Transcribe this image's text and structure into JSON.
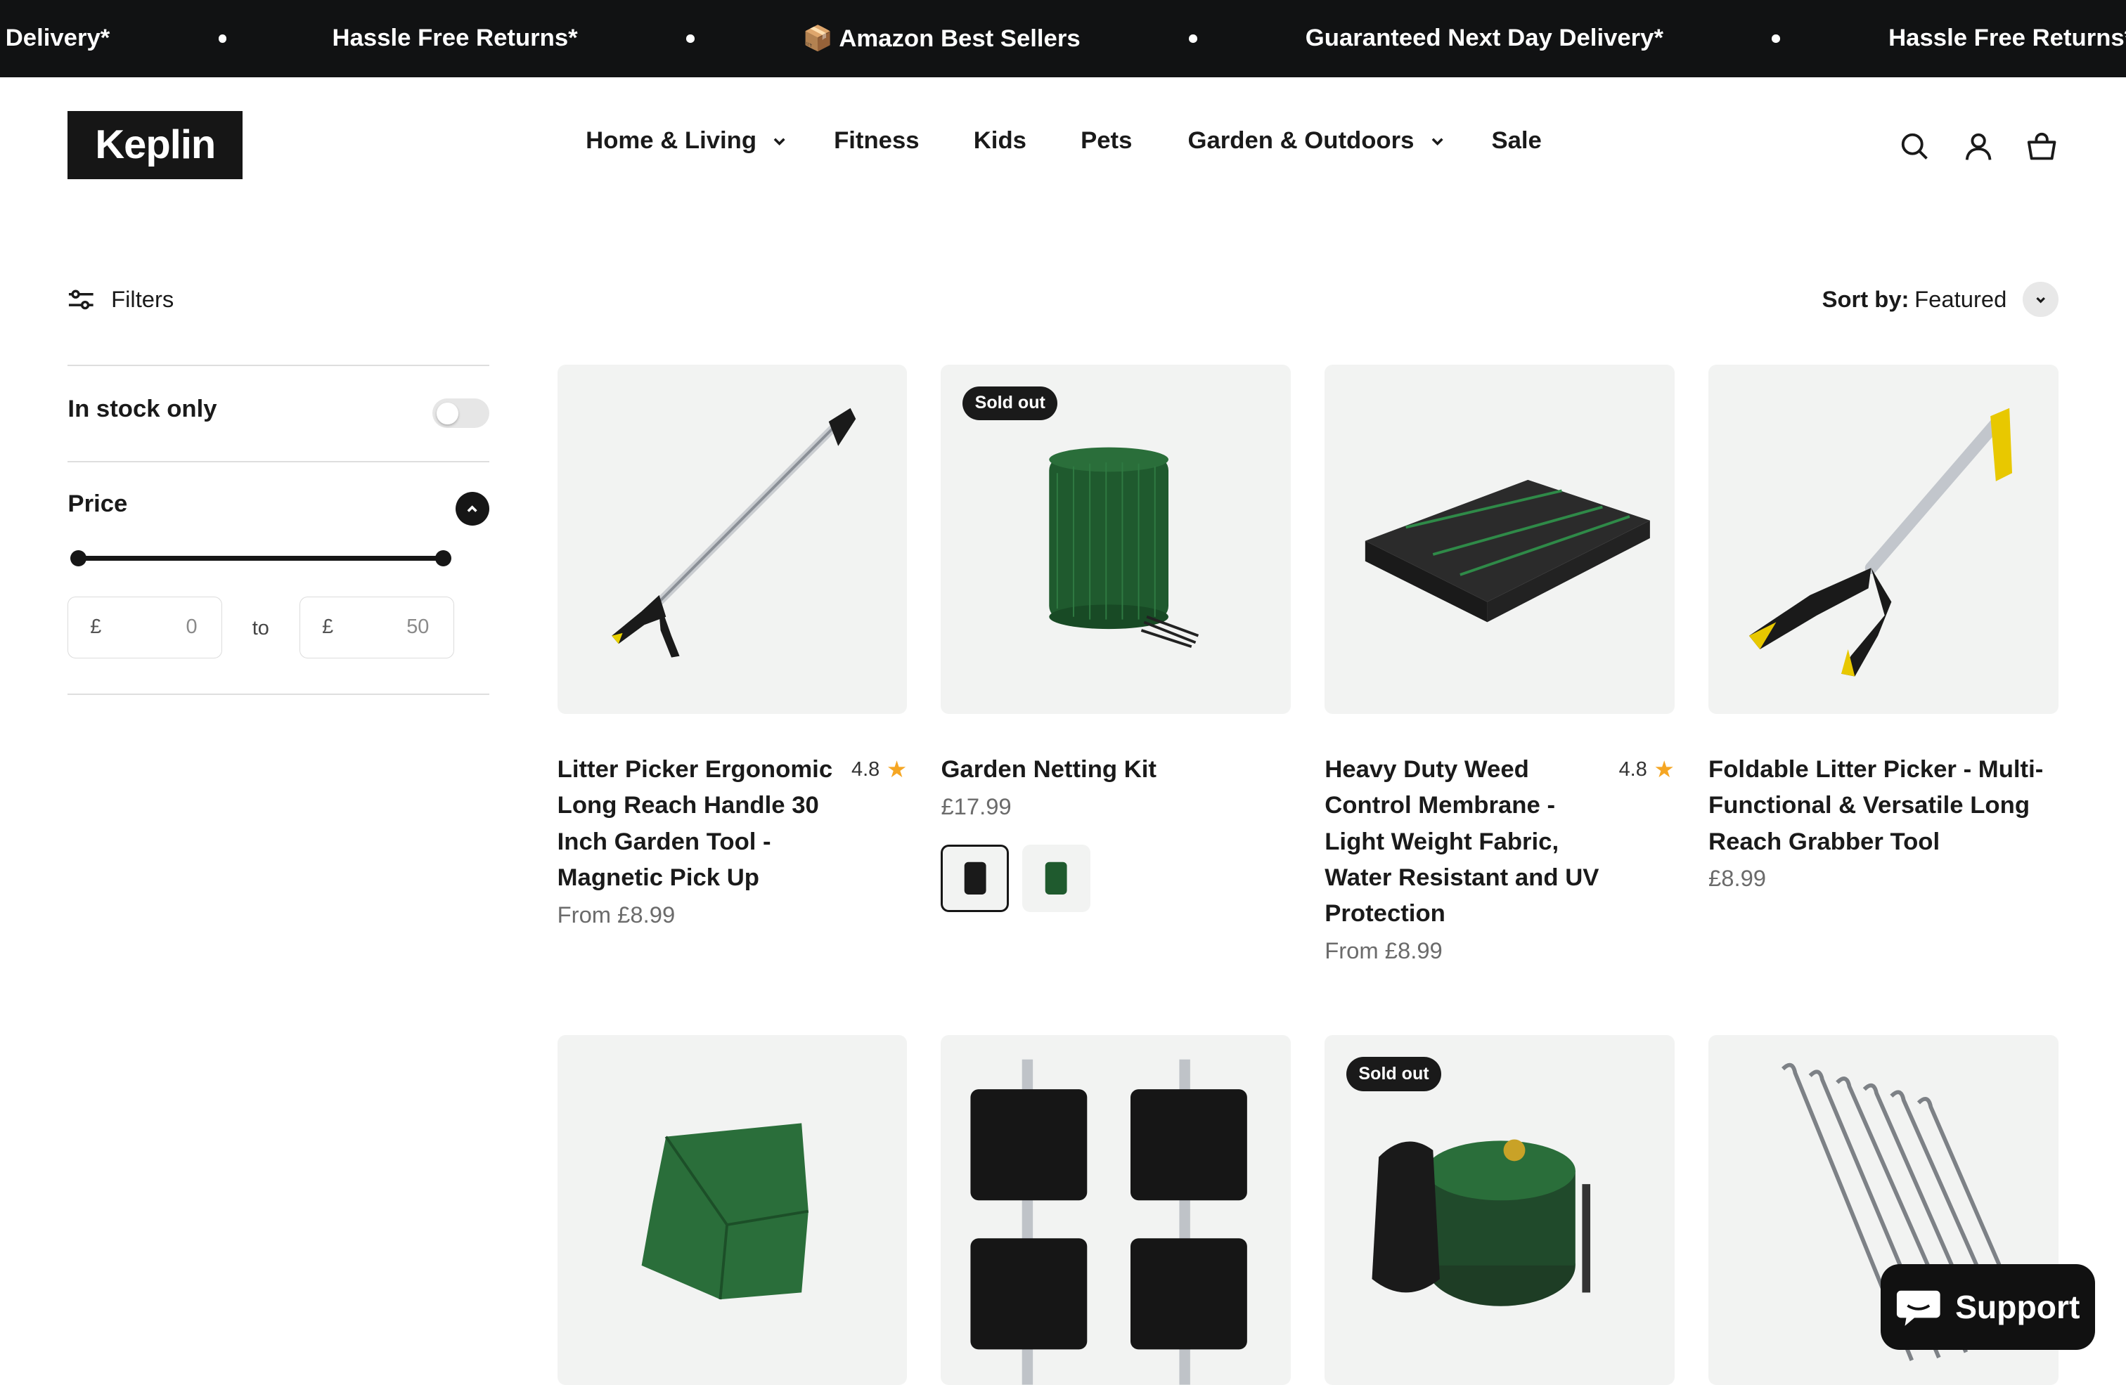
{
  "announcement": {
    "items": [
      "Delivery*",
      "Hassle Free Returns*",
      "📦 Amazon Best Sellers",
      "Guaranteed Next Day Delivery*",
      "Hassle Free Returns*"
    ]
  },
  "header": {
    "logo": "Keplin",
    "nav": [
      {
        "label": "Home & Living",
        "dropdown": true
      },
      {
        "label": "Fitness",
        "dropdown": false
      },
      {
        "label": "Kids",
        "dropdown": false
      },
      {
        "label": "Pets",
        "dropdown": false
      },
      {
        "label": "Garden & Outdoors",
        "dropdown": true
      },
      {
        "label": "Sale",
        "dropdown": false
      }
    ],
    "icons": [
      "search-icon",
      "account-icon",
      "cart-icon"
    ]
  },
  "toolbar": {
    "filters_label": "Filters",
    "sort_label": "Sort by:",
    "sort_value": "Featured"
  },
  "filters": {
    "in_stock_label": "In stock only",
    "in_stock_checked": false,
    "price_label": "Price",
    "currency": "£",
    "min_value": "0",
    "max_value": "50",
    "to_label": "to"
  },
  "products": [
    {
      "title": "Litter Picker Ergonomic Long Reach Handle 30 Inch Garden Tool - Magnetic Pick Up",
      "rating": "4.8",
      "price": "From £8.99",
      "badge": null
    },
    {
      "title": "Garden Netting Kit",
      "rating": null,
      "price": "£17.99",
      "badge": "Sold out"
    },
    {
      "title": "Heavy Duty Weed Control Membrane - Light Weight Fabric, Water Resistant and UV Protection",
      "rating": "4.8",
      "price": "From £8.99",
      "badge": null
    },
    {
      "title": "Foldable Litter Picker - Multi-Functional & Versatile Long Reach Grabber Tool",
      "rating": null,
      "price": "£8.99",
      "badge": null
    },
    {
      "title": "",
      "rating": null,
      "price": "",
      "badge": null
    },
    {
      "title": "",
      "rating": null,
      "price": "",
      "badge": null
    },
    {
      "title": "",
      "rating": null,
      "price": "",
      "badge": "Sold out"
    },
    {
      "title": "",
      "rating": null,
      "price": "",
      "badge": null
    }
  ],
  "support": {
    "label": "Support"
  },
  "colors": {
    "dark": "#111213",
    "accent_star": "#f5a623",
    "card_bg": "#f2f3f2",
    "green": "#1f5a2e"
  }
}
